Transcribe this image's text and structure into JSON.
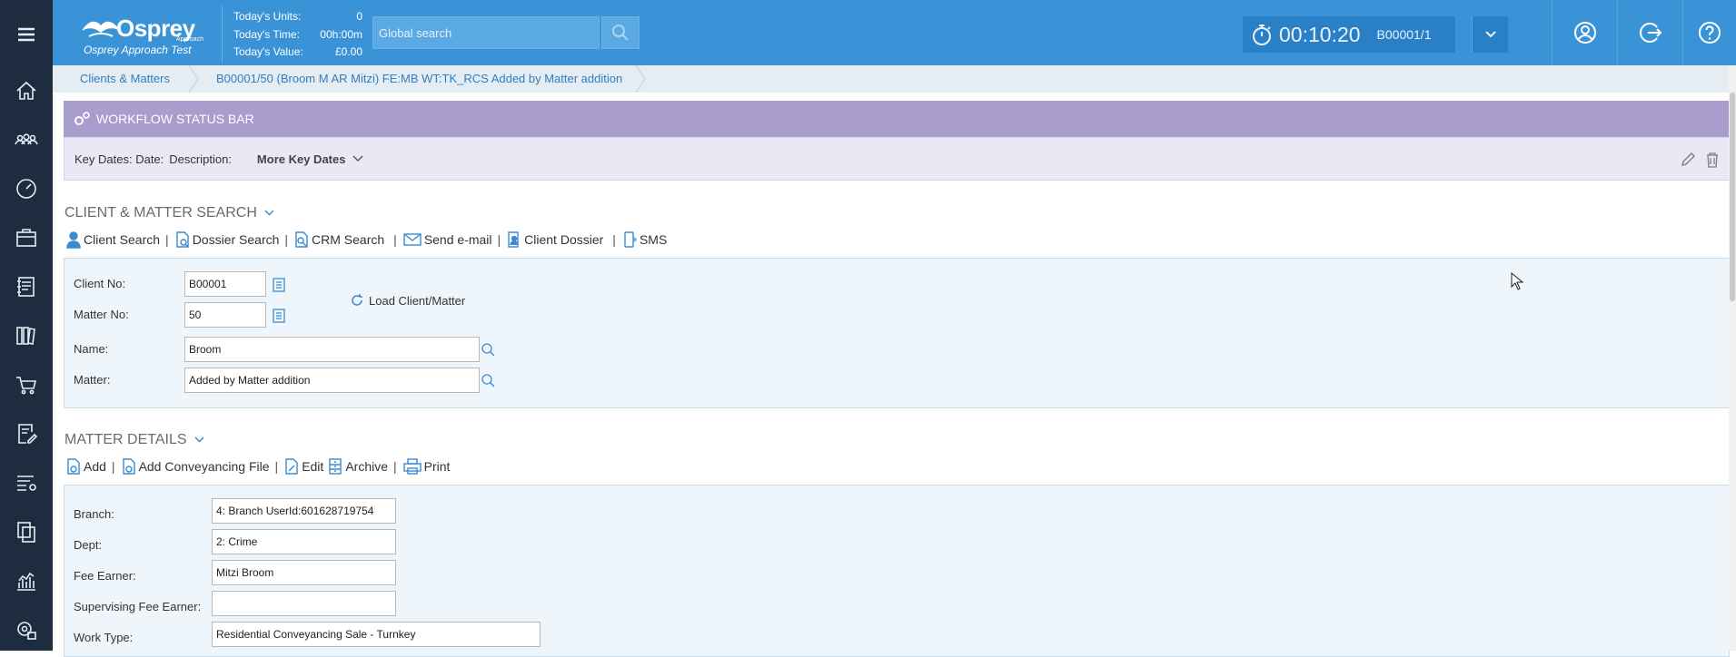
{
  "sidebar": {
    "menu_icon": "hamburger-menu-icon",
    "items": [
      {
        "icon": "home-icon"
      },
      {
        "icon": "clients-icon"
      },
      {
        "icon": "dashboard-icon"
      },
      {
        "icon": "briefcase-icon"
      },
      {
        "icon": "document-icon"
      },
      {
        "icon": "library-icon"
      },
      {
        "icon": "cart-icon"
      },
      {
        "icon": "edit-document-icon"
      },
      {
        "icon": "settings-list-icon"
      },
      {
        "icon": "copy-icon"
      },
      {
        "icon": "reports-icon"
      },
      {
        "icon": "admin-settings-icon"
      }
    ]
  },
  "header": {
    "brand": "Osprey",
    "brand_sub": "Approach",
    "environment": "Osprey Approach Test",
    "stats": [
      {
        "label": "Today's Units:",
        "value": "0"
      },
      {
        "label": "Today's Time:",
        "value": "00h:00m"
      },
      {
        "label": "Today's Value:",
        "value": "£0.00"
      }
    ],
    "search_placeholder": "Global search",
    "timer": {
      "time": "00:10:20",
      "matter": "B00001/1"
    }
  },
  "breadcrumbs": [
    "Clients & Matters",
    "B00001/50 (Broom M AR Mitzi) FE:MB WT:TK_RCS Added by Matter addition"
  ],
  "workflow": {
    "title": "WORKFLOW STATUS BAR",
    "key_dates_label": "Key Dates: Date:",
    "description_label": "Description:",
    "more_key_dates": "More Key Dates"
  },
  "client_matter_search": {
    "title": "CLIENT & MATTER SEARCH",
    "toolbar": [
      "Client Search",
      "Dossier Search",
      "CRM Search",
      "Send e-mail",
      "Client Dossier",
      "SMS"
    ],
    "fields": {
      "client_no_label": "Client No:",
      "client_no": "B00001",
      "matter_no_label": "Matter No:",
      "matter_no": "50",
      "name_label": "Name:",
      "name": "Broom",
      "matter_label": "Matter:",
      "matter": "Added by Matter addition"
    },
    "load_label": "Load Client/Matter"
  },
  "matter_details": {
    "title": "MATTER DETAILS",
    "toolbar": [
      "Add",
      "Add Conveyancing File",
      "Edit",
      "Archive",
      "Print"
    ],
    "fields": {
      "branch_label": "Branch:",
      "branch": "4: Branch UserId:601628719754",
      "dept_label": "Dept:",
      "dept": "2: Crime",
      "fee_earner_label": "Fee Earner:",
      "fee_earner": "Mitzi Broom",
      "supervising_label": "Supervising Fee Earner:",
      "supervising": "",
      "work_type_label": "Work Type:",
      "work_type": "Residential Conveyancing Sale - Turnkey"
    }
  },
  "colors": {
    "sidebar": "#1e2c3f",
    "topbar": "#3a93d6",
    "workflow": "#a89dcc",
    "accent": "#3a8ad0"
  }
}
